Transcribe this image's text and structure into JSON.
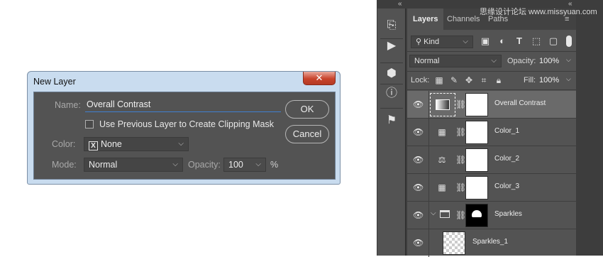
{
  "dialog": {
    "title": "New Layer",
    "close_glyph": "✕",
    "name_label": "Name:",
    "name_value": "Overall Contrast",
    "clip_label": "Use Previous Layer to Create Clipping Mask",
    "color_label": "Color:",
    "color_value": "None",
    "mode_label": "Mode:",
    "mode_value": "Normal",
    "opacity_label": "Opacity:",
    "opacity_value": "100",
    "opacity_unit": "%",
    "ok_label": "OK",
    "cancel_label": "Cancel"
  },
  "watermark": "思缘设计论坛 www.missyuan.com",
  "panel": {
    "collapse_glyph": "«",
    "tabs": [
      "Layers",
      "Channels",
      "Paths"
    ],
    "filter_kind": "Kind",
    "blend_mode": "Normal",
    "opacity_label": "Opacity:",
    "opacity_value": "100%",
    "lock_label": "Lock:",
    "fill_label": "Fill:",
    "fill_value": "100%",
    "layers": [
      {
        "name": "Overall Contrast",
        "icon": "levels-icon",
        "selected": true
      },
      {
        "name": "Color_1",
        "icon": "curves-icon",
        "selected": false
      },
      {
        "name": "Color_2",
        "icon": "color-balance-icon",
        "selected": false
      },
      {
        "name": "Color_3",
        "icon": "curves-icon",
        "selected": false
      },
      {
        "name": "Sparkles",
        "icon": "folder-icon",
        "selected": false
      },
      {
        "name": "Sparkles_1",
        "icon": "pixel-layer",
        "selected": false
      }
    ]
  },
  "colors": {
    "panel_bg": "#535353",
    "dialog_frame": "#c9dcef",
    "accent_blue": "#3f7fd1",
    "close_red": "#c8442c"
  }
}
